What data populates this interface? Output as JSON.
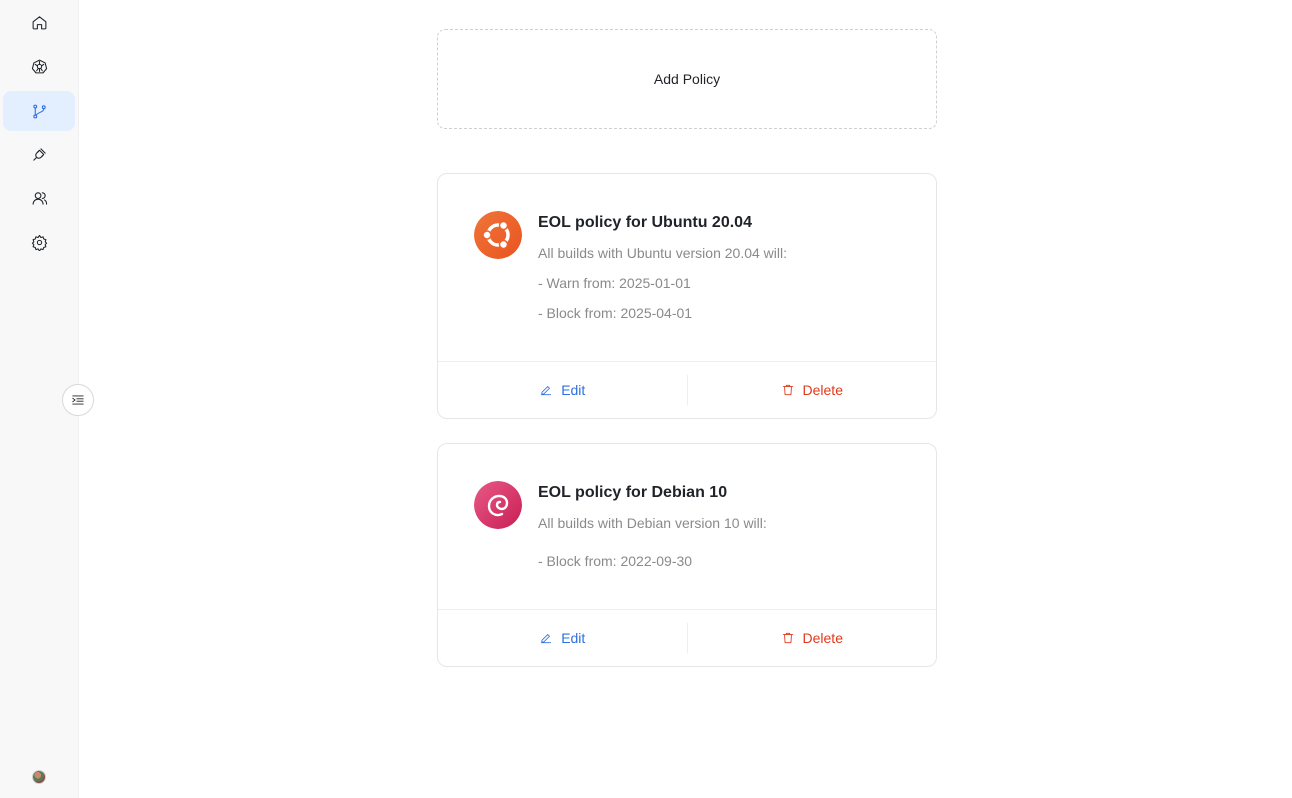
{
  "sidebar": {
    "items": [
      {
        "name": "home",
        "icon": "home-icon",
        "active": false
      },
      {
        "name": "kubernetes",
        "icon": "helm-icon",
        "active": false
      },
      {
        "name": "policies",
        "icon": "git-branch-icon",
        "active": true
      },
      {
        "name": "integrations",
        "icon": "plug-icon",
        "active": false
      },
      {
        "name": "users",
        "icon": "users-icon",
        "active": false
      },
      {
        "name": "settings",
        "icon": "gear-icon",
        "active": false
      }
    ],
    "collapse_icon": "indent-icon",
    "accent": "#2f6fe4"
  },
  "add_policy_label": "Add Policy",
  "policies": [
    {
      "title": "EOL policy for Ubuntu 20.04",
      "description": "All builds with Ubuntu version 20.04 will:",
      "lines": [
        "- Warn from: 2025-01-01",
        "- Block from: 2025-04-01"
      ],
      "logo": "ubuntu-logo",
      "logo_color": "#e9541f",
      "edit_label": "Edit",
      "delete_label": "Delete"
    },
    {
      "title": "EOL policy for Debian 10",
      "description": "All builds with Debian version 10 will:",
      "lines": [
        "- Block from: 2022-09-30"
      ],
      "logo": "debian-logo",
      "logo_color": "#d70a53",
      "edit_label": "Edit",
      "delete_label": "Delete"
    }
  ],
  "colors": {
    "edit": "#2f6fe4",
    "delete": "#e0391b"
  }
}
